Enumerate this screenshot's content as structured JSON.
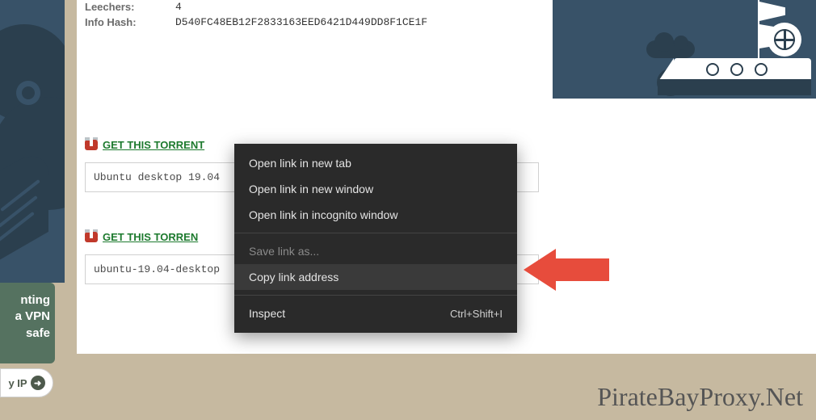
{
  "info": {
    "leechers_label": "Leechers:",
    "leechers_value": "4",
    "infohash_label": "Info Hash:",
    "infohash_value": "D540FC48EB12F2833163EED6421D449DD8F1CE1F"
  },
  "torrent_links": {
    "primary_label": "GET THIS TORRENT",
    "secondary_label": "GET THIS TORREN",
    "field1_value": "Ubuntu desktop 19.04",
    "field2_value": "ubuntu-19.04-desktop"
  },
  "vpn_card": {
    "line1": "nting",
    "line2": "a VPN",
    "line3": "safe"
  },
  "ip_button": {
    "label": "y IP"
  },
  "context_menu": {
    "items": [
      {
        "label": "Open link in new tab",
        "shortcut": "",
        "disabled": false
      },
      {
        "label": "Open link in new window",
        "shortcut": "",
        "disabled": false
      },
      {
        "label": "Open link in incognito window",
        "shortcut": "",
        "disabled": false
      }
    ],
    "items2": [
      {
        "label": "Save link as...",
        "shortcut": "",
        "disabled": true
      },
      {
        "label": "Copy link address",
        "shortcut": "",
        "disabled": false
      }
    ],
    "items3": [
      {
        "label": "Inspect",
        "shortcut": "Ctrl+Shift+I",
        "disabled": false
      }
    ]
  },
  "site_name": "PirateBayProxy.Net"
}
